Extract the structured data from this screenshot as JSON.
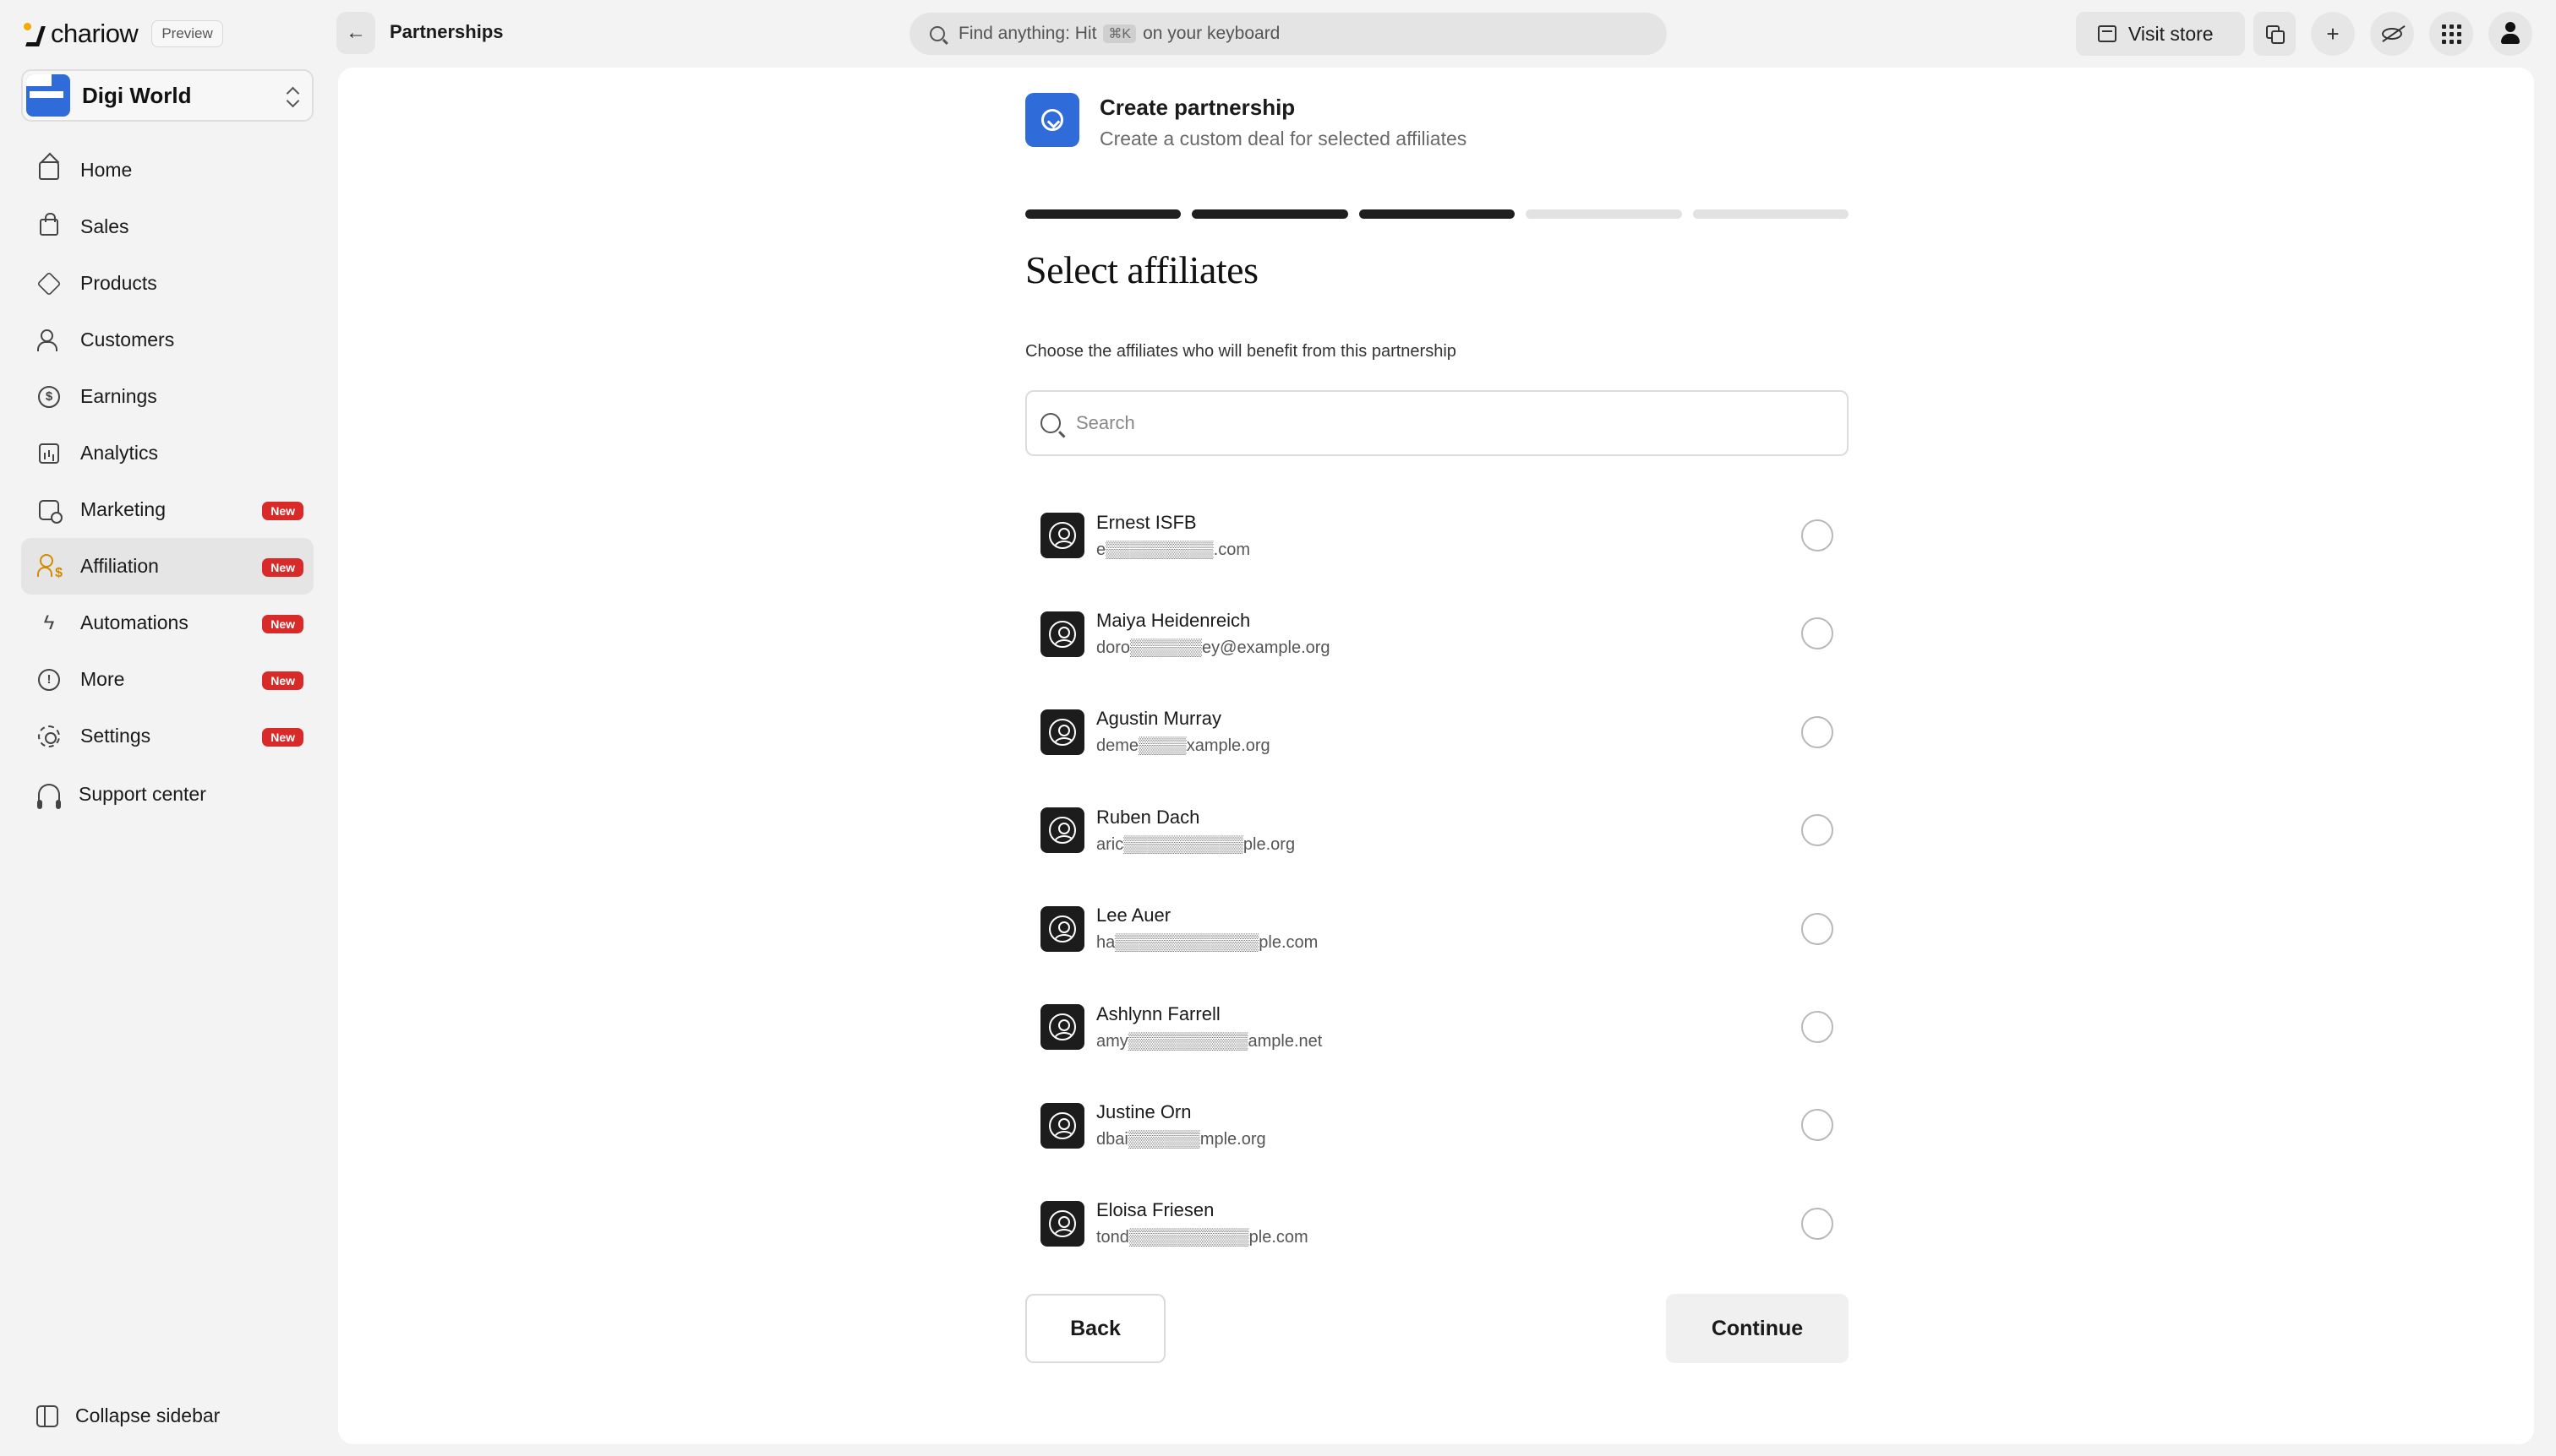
{
  "brand": {
    "name": "chariow",
    "badge": "Preview"
  },
  "header": {
    "breadcrumb": "Partnerships",
    "search_placeholder_prefix": "Find anything: Hit",
    "search_shortcut": "⌘K",
    "search_placeholder_suffix": "on your keyboard",
    "visit_store_label": "Visit store"
  },
  "sidebar": {
    "store_name": "Digi World",
    "items": [
      {
        "label": "Home",
        "icon": "home-icon",
        "badge": ""
      },
      {
        "label": "Sales",
        "icon": "shopping-bag-icon",
        "badge": ""
      },
      {
        "label": "Products",
        "icon": "box-icon",
        "badge": ""
      },
      {
        "label": "Customers",
        "icon": "users-icon",
        "badge": ""
      },
      {
        "label": "Earnings",
        "icon": "coin-icon",
        "badge": ""
      },
      {
        "label": "Analytics",
        "icon": "chart-icon",
        "badge": ""
      },
      {
        "label": "Marketing",
        "icon": "marketing-icon",
        "badge": "New"
      },
      {
        "label": "Affiliation",
        "icon": "affiliation-icon",
        "badge": "New",
        "active": true
      },
      {
        "label": "Automations",
        "icon": "lightning-icon",
        "badge": "New"
      },
      {
        "label": "More",
        "icon": "info-icon",
        "badge": "New"
      },
      {
        "label": "Settings",
        "icon": "gear-icon",
        "badge": "New"
      }
    ],
    "support_label": "Support center",
    "collapse_label": "Collapse sidebar"
  },
  "wizard": {
    "title": "Create partnership",
    "subtitle": "Create a custom deal for selected affiliates",
    "total_steps": 5,
    "completed_steps": 3,
    "step_heading": "Select affiliates",
    "description": "Choose the affiliates who will benefit from this partnership",
    "search_placeholder": "Search",
    "back_label": "Back",
    "continue_label": "Continue"
  },
  "affiliates": [
    {
      "name": "Ernest ISFB",
      "email": "e▒▒▒▒▒▒▒▒▒.com",
      "selected": false
    },
    {
      "name": "Maiya Heidenreich",
      "email": "doro▒▒▒▒▒▒ey@example.org",
      "selected": false
    },
    {
      "name": "Agustin Murray",
      "email": "deme▒▒▒▒xample.org",
      "selected": false
    },
    {
      "name": "Ruben Dach",
      "email": "aric▒▒▒▒▒▒▒▒▒▒ple.org",
      "selected": false
    },
    {
      "name": "Lee Auer",
      "email": "ha▒▒▒▒▒▒▒▒▒▒▒▒ple.com",
      "selected": false
    },
    {
      "name": "Ashlynn Farrell",
      "email": "amy▒▒▒▒▒▒▒▒▒▒ample.net",
      "selected": false
    },
    {
      "name": "Justine Orn",
      "email": "dbai▒▒▒▒▒▒mple.org",
      "selected": false
    },
    {
      "name": "Eloisa Friesen",
      "email": "tond▒▒▒▒▒▒▒▒▒▒ple.com",
      "selected": false
    }
  ]
}
